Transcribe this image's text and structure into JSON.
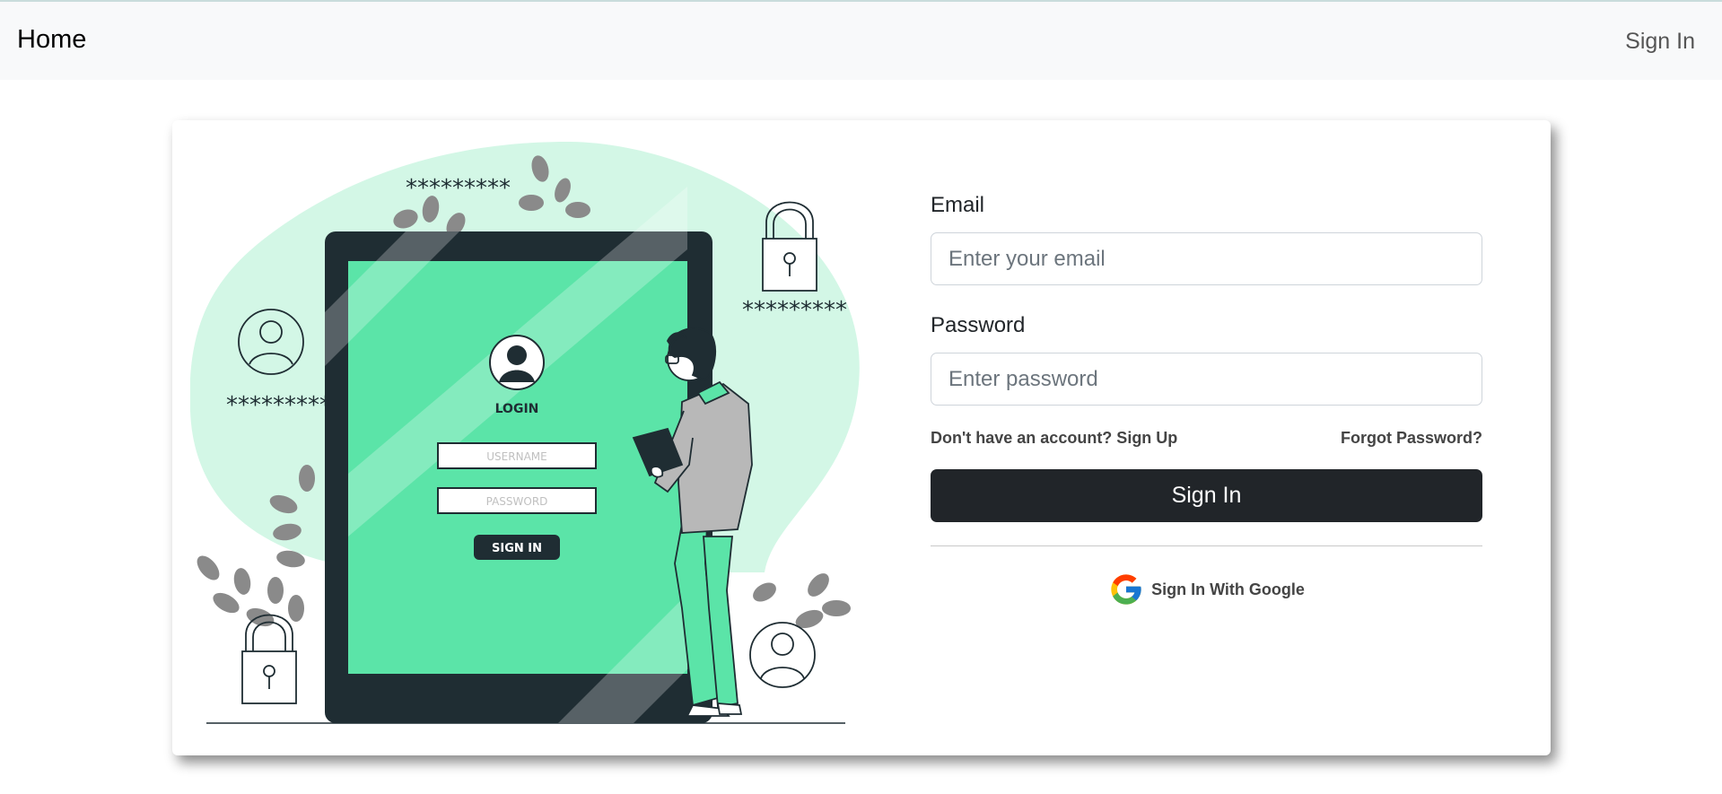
{
  "nav": {
    "brand": "Home",
    "signin_link": "Sign In"
  },
  "illustration": {
    "login_title": "LOGIN",
    "username_placeholder": "USERNAME",
    "password_placeholder": "PASSWORD",
    "signin_button": "SIGN IN",
    "asterisks": "*********"
  },
  "form": {
    "email_label": "Email",
    "email_placeholder": "Enter your email",
    "email_value": "",
    "password_label": "Password",
    "password_placeholder": "Enter password",
    "password_value": "",
    "signup_link": "Don't have an account? Sign Up",
    "forgot_link": "Forgot Password?",
    "signin_button": "Sign In",
    "google_button": "Sign In With Google"
  },
  "colors": {
    "accent_green": "#5be4a8",
    "blob_green": "#d3f7e6",
    "dark": "#212529",
    "device_dark": "#1f2d33"
  },
  "icons": [
    "google-icon",
    "user-icon",
    "lock-icon",
    "leaf-icon"
  ]
}
